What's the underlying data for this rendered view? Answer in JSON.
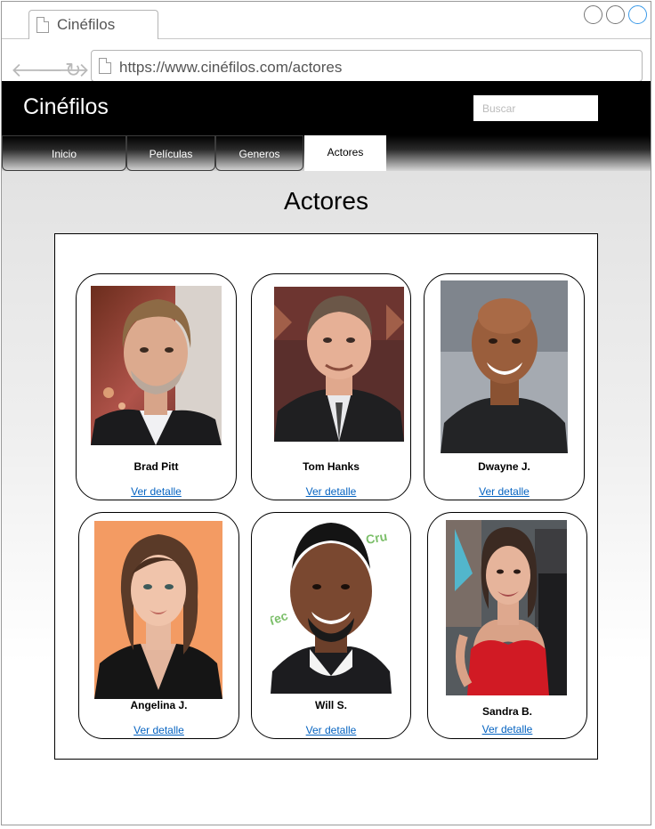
{
  "browser": {
    "tab_title": "Cinéfilos",
    "url": "https://www.cinéfilos.com/actores"
  },
  "site": {
    "title": "Cinéfilos",
    "search_placeholder": "Buscar",
    "nav": [
      "Inicio",
      "Películas",
      "Generos",
      "Actores"
    ],
    "active_tab": "Actores",
    "page_title": "Actores"
  },
  "actors": [
    {
      "name": "Brad Pitt",
      "link": "Ver detalle"
    },
    {
      "name": "Tom Hanks",
      "link": "Ver detalle"
    },
    {
      "name": "Dwayne J.",
      "link": "Ver detalle"
    },
    {
      "name": "Angelina J.",
      "link": "Ver detalle"
    },
    {
      "name": "Will S.",
      "link": "Ver detalle"
    },
    {
      "name": "Sandra B.",
      "link": "Ver detalle"
    }
  ],
  "colors": {
    "header": "#000000",
    "link": "#0563c1",
    "active_tab": "#ffffff"
  }
}
